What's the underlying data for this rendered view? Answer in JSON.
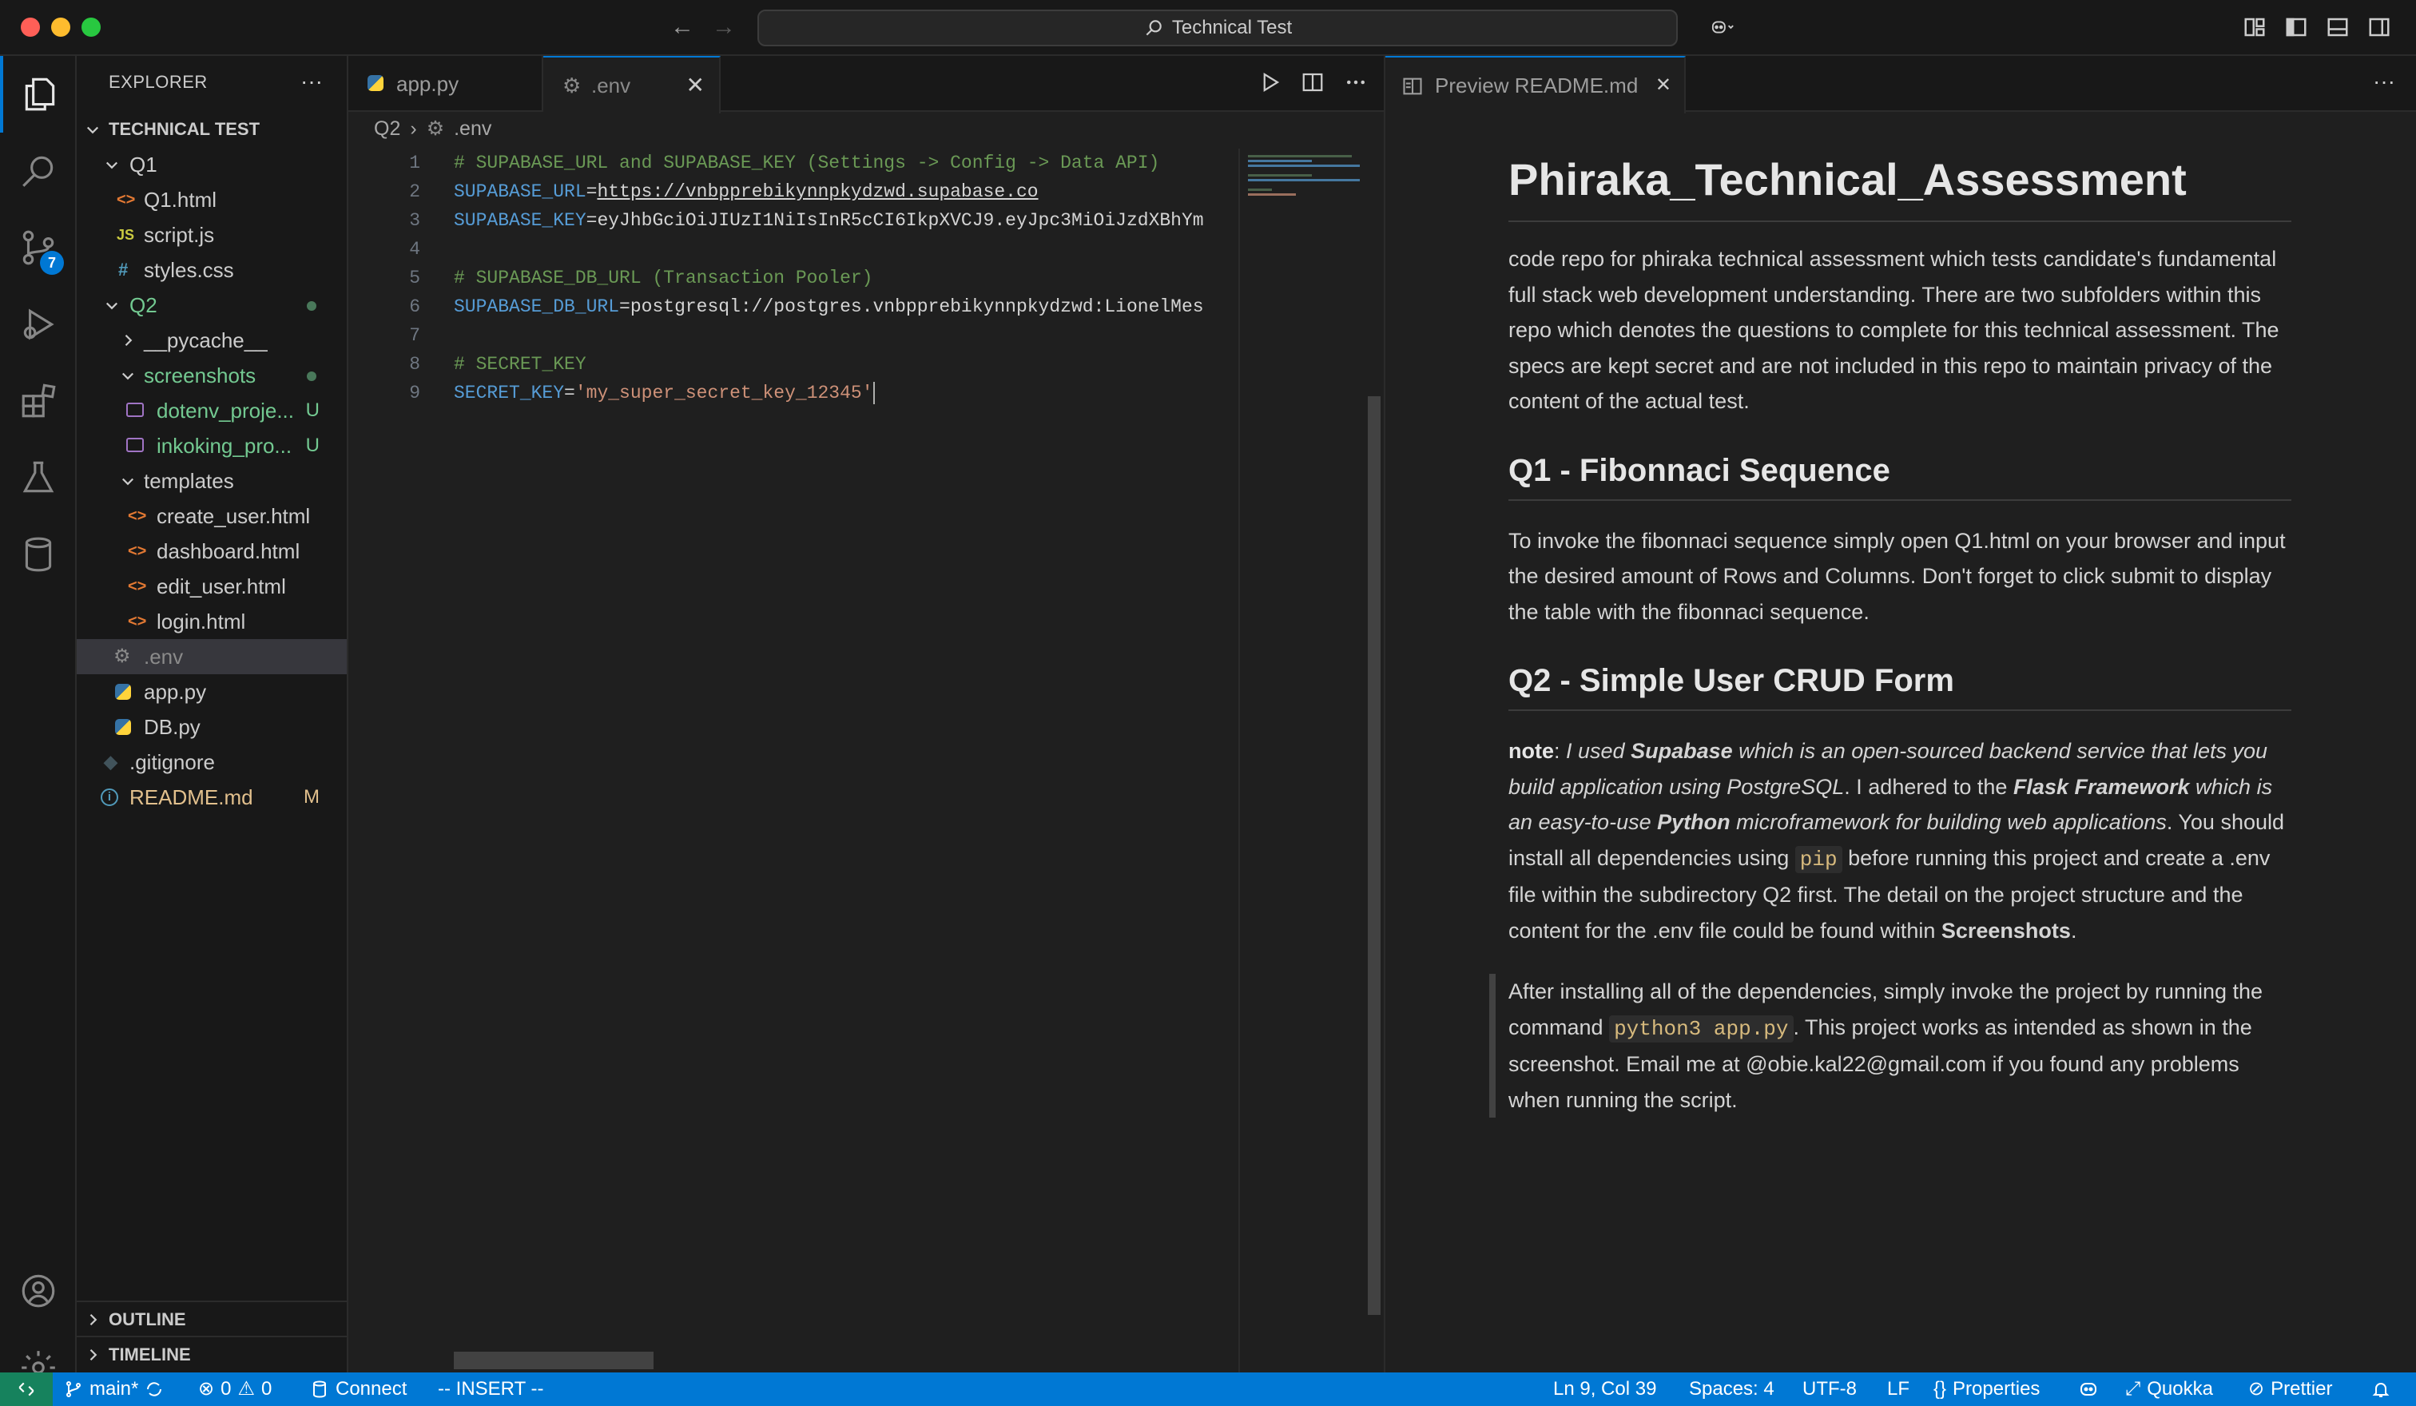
{
  "window": {
    "title": "Technical Test"
  },
  "colors": {
    "accent": "#0078d4",
    "statusbar": "#0078d4",
    "remote": "#16825d",
    "untracked": "#73c991",
    "modified": "#e2c08d",
    "folder_changed": "#73c991"
  },
  "activitybar": {
    "items": [
      {
        "icon": "explorer-icon",
        "active": true
      },
      {
        "icon": "search-icon"
      },
      {
        "icon": "source-control-icon",
        "badge": "7"
      },
      {
        "icon": "run-debug-icon"
      },
      {
        "icon": "extensions-icon"
      },
      {
        "icon": "testing-icon"
      },
      {
        "icon": "database-icon"
      }
    ],
    "bottom": [
      {
        "icon": "account-icon"
      },
      {
        "icon": "settings-gear-icon"
      }
    ]
  },
  "sidebar": {
    "header": "EXPLORER",
    "more": "···",
    "root": "TECHNICAL TEST",
    "tree": [
      {
        "label": "Q1",
        "type": "folder",
        "expanded": true
      },
      {
        "label": "Q1.html",
        "type": "html",
        "icon_text": "<>"
      },
      {
        "label": "script.js",
        "type": "js",
        "icon_text": "JS"
      },
      {
        "label": "styles.css",
        "type": "css",
        "icon_text": "#"
      },
      {
        "label": "Q2",
        "type": "folder",
        "expanded": true
      },
      {
        "label": "__pycache__",
        "type": "folder",
        "expanded": false
      },
      {
        "label": "screenshots",
        "type": "folder",
        "expanded": true
      },
      {
        "label": "dotenv_proje...",
        "type": "image",
        "decoration": "U"
      },
      {
        "label": "inkoking_pro...",
        "type": "image",
        "decoration": "U"
      },
      {
        "label": "templates",
        "type": "folder",
        "expanded": true
      },
      {
        "label": "create_user.html",
        "type": "html",
        "icon_text": "<>"
      },
      {
        "label": "dashboard.html",
        "type": "html",
        "icon_text": "<>"
      },
      {
        "label": "edit_user.html",
        "type": "html",
        "icon_text": "<>"
      },
      {
        "label": "login.html",
        "type": "html",
        "icon_text": "<>"
      },
      {
        "label": ".env",
        "type": "env"
      },
      {
        "label": "app.py",
        "type": "python"
      },
      {
        "label": "DB.py",
        "type": "python"
      },
      {
        "label": ".gitignore",
        "type": "git"
      },
      {
        "label": "README.md",
        "type": "info",
        "decoration": "M"
      }
    ],
    "sections": [
      "OUTLINE",
      "TIMELINE"
    ]
  },
  "editor": {
    "tabs": [
      {
        "label": "app.py",
        "active": false
      },
      {
        "label": ".env",
        "active": true
      }
    ],
    "breadcrumb": [
      "Q2",
      ".env"
    ],
    "lines": [
      {
        "n": "1",
        "parts": [
          {
            "t": "# SUPABASE_URL and SUPABASE_KEY (Settings -> Config -> Data API)",
            "c": "comment"
          }
        ]
      },
      {
        "n": "2",
        "parts": [
          {
            "t": "SUPABASE_URL",
            "c": "key"
          },
          {
            "t": "=",
            "c": "op"
          },
          {
            "t": "https://vnbpprebikynnpkydzwd.supabase.co",
            "c": "url"
          }
        ]
      },
      {
        "n": "3",
        "parts": [
          {
            "t": "SUPABASE_KEY",
            "c": "key"
          },
          {
            "t": "=",
            "c": "op"
          },
          {
            "t": "eyJhbGciOiJIUzI1NiIsInR5cCI6IkpXVCJ9.eyJpc3MiOiJzdXBhYm",
            "c": "val"
          }
        ]
      },
      {
        "n": "4",
        "parts": []
      },
      {
        "n": "5",
        "parts": [
          {
            "t": "# SUPABASE_DB_URL (Transaction Pooler)",
            "c": "comment"
          }
        ]
      },
      {
        "n": "6",
        "parts": [
          {
            "t": "SUPABASE_DB_URL",
            "c": "key"
          },
          {
            "t": "=",
            "c": "op"
          },
          {
            "t": "postgresql://postgres.vnbpprebikynnpkydzwd:LionelMes",
            "c": "val"
          }
        ]
      },
      {
        "n": "7",
        "parts": []
      },
      {
        "n": "8",
        "parts": [
          {
            "t": "# SECRET_KEY",
            "c": "comment"
          }
        ]
      },
      {
        "n": "9",
        "parts": [
          {
            "t": "SECRET_KEY",
            "c": "key"
          },
          {
            "t": "=",
            "c": "op"
          },
          {
            "t": "'my_super_secret_key_12345'",
            "c": "str"
          }
        ],
        "cursor": true
      }
    ]
  },
  "preview": {
    "tab_label": "Preview README.md",
    "title": "Phiraka_Technical_Assessment",
    "intro": "code repo for phiraka technical assessment which tests candidate's fundamental full stack web development understanding. There are two subfolders within this repo which denotes the questions to complete for this technical assessment. The specs are kept secret and are not included in this repo to maintain privacy of the content of the actual test.",
    "q1_heading": "Q1 - Fibonnaci Sequence",
    "q1_text": "To invoke the fibonnaci sequence simply open Q1.html on your browser and input the desired amount of Rows and Columns. Don't forget to click submit to display the table with the fibonnaci sequence.",
    "q2_heading": "Q2 - Simple User CRUD Form",
    "q2_note": {
      "label": "note",
      "t1": "I used ",
      "supabase": "Supabase",
      "t2": " which is an open-sourced backend service that lets you build application using PostgreSQL",
      "t3": ". I adhered to the ",
      "flask": "Flask Framework",
      "t4": " which is an easy-to-use ",
      "python": "Python",
      "t5": " microframework for building web applications",
      "t6": ". You should install all dependencies using ",
      "pip": "pip",
      "t7": " before running this project and create a .env file within the subdirectory Q2 first. The detail on the project structure and the content for the .env file could be found within ",
      "screenshots": "Screenshots",
      "t8": "."
    },
    "quote": {
      "t1": "After installing all of the dependencies, simply invoke the project by running the command ",
      "cmd": "python3 app.py",
      "t2": ". This project works as intended as shown in the screenshot. Email me at @obie.kal22@gmail.com if you found any problems when running the script."
    }
  },
  "statusbar": {
    "branch": "main*",
    "errors": "0",
    "warnings": "0",
    "connect": "Connect",
    "mode": "-- INSERT --",
    "position": "Ln 9, Col 39",
    "spaces": "Spaces: 4",
    "encoding": "UTF-8",
    "eol": "LF",
    "properties": "Properties",
    "quokka": "Quokka",
    "prettier": "Prettier"
  }
}
